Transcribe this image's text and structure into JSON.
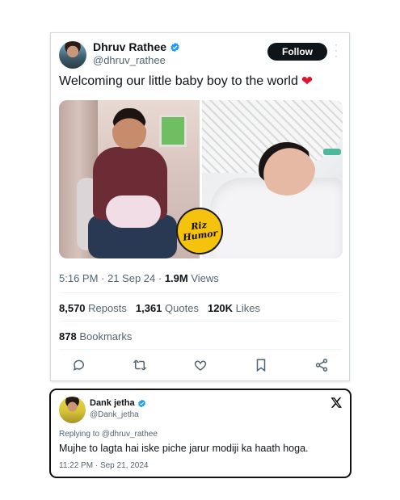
{
  "main_tweet": {
    "author_name": "Dhruv Rathee",
    "author_handle": "@dhruv_rathee",
    "follow_label": "Follow",
    "text": "Welcoming our little baby boy to the world",
    "emoji": "❤",
    "watermark": {
      "line1": "Riz",
      "line2": "Humor"
    },
    "time": "5:16 PM",
    "date": "21 Sep 24",
    "views_count": "1.9M",
    "views_label": "Views",
    "reposts_count": "8,570",
    "reposts_label": "Reposts",
    "quotes_count": "1,361",
    "quotes_label": "Quotes",
    "likes_count": "120K",
    "likes_label": "Likes",
    "bookmarks_count": "878",
    "bookmarks_label": "Bookmarks",
    "icons": [
      "reply-icon",
      "repost-icon",
      "like-icon",
      "bookmark-icon",
      "share-icon"
    ]
  },
  "reply_tweet": {
    "author_name": "Dank jetha",
    "author_handle": "@Dank_jetha",
    "replying_to": "Replying to @dhruv_rathee",
    "text": "Mujhe to lagta hai iske piche jarur modiji ka haath hoga.",
    "timestamp": "11:22 PM · Sep 21, 2024"
  },
  "colors": {
    "verified_blue": "#1d9bf0",
    "heart_red": "#e0152b",
    "watermark_yellow": "#f5c20d",
    "text_primary": "#0f1419",
    "text_secondary": "#536471"
  }
}
